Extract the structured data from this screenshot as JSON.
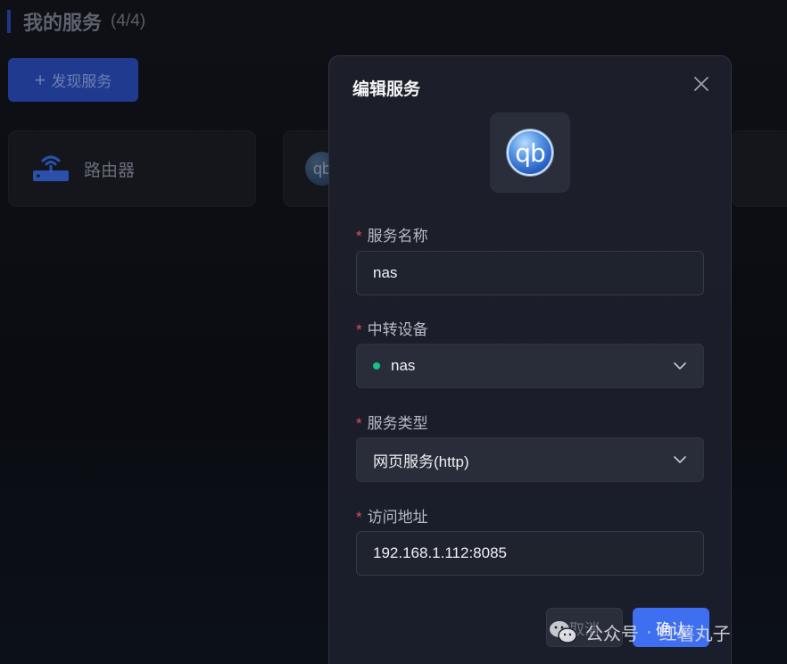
{
  "background": {
    "section_title": "我的服务",
    "section_count": "(4/4)",
    "discover_button": "发现服务",
    "cards": [
      {
        "label": "路由器",
        "icon": "router-icon"
      },
      {
        "label": "",
        "icon": "qbittorrent-icon"
      }
    ]
  },
  "modal": {
    "title": "编辑服务",
    "service_icon": "qbittorrent-logo",
    "service_icon_text": "qb",
    "fields": {
      "name": {
        "label": "服务名称",
        "value": "nas"
      },
      "relay_device": {
        "label": "中转设备",
        "value": "nas",
        "status_color": "#19c18a"
      },
      "service_type": {
        "label": "服务类型",
        "value": "网页服务(http)"
      },
      "address": {
        "label": "访问地址",
        "value": "192.168.1.112:8085"
      }
    },
    "cancel_label": "取消",
    "confirm_label": "确认"
  },
  "watermark": {
    "platform": "公众号",
    "separator": "·",
    "author": "红薯丸子"
  },
  "colors": {
    "accent": "#3d6ff0",
    "required": "#e0524f",
    "online": "#19c18a"
  }
}
